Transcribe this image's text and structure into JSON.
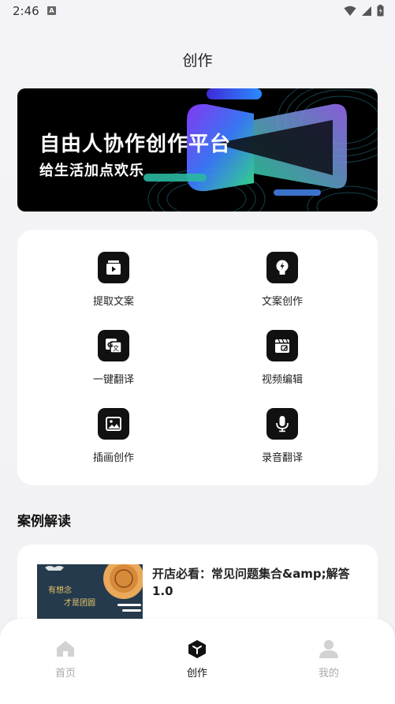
{
  "status": {
    "time": "2:46",
    "indicator": "A"
  },
  "page": {
    "title": "创作"
  },
  "banner": {
    "title": "自由人协作创作平台",
    "subtitle": "给生活加点欢乐"
  },
  "tools": [
    {
      "label": "提取文案",
      "icon": "video-extract-icon"
    },
    {
      "label": "文案创作",
      "icon": "lightbulb-icon"
    },
    {
      "label": "一键翻译",
      "icon": "translate-icon"
    },
    {
      "label": "视频编辑",
      "icon": "clapperboard-icon"
    },
    {
      "label": "插画创作",
      "icon": "image-icon"
    },
    {
      "label": "录音翻译",
      "icon": "microphone-icon"
    }
  ],
  "cases": {
    "heading": "案例解读",
    "items": [
      {
        "title": "开店必看：常见问题集合&amp;解答1.0",
        "thumb_text_1": "有想念",
        "thumb_text_2": "才是团圆"
      }
    ]
  },
  "nav": [
    {
      "label": "首页",
      "icon": "home-icon"
    },
    {
      "label": "创作",
      "icon": "cube-icon",
      "active": true
    },
    {
      "label": "我的",
      "icon": "user-icon"
    }
  ],
  "colors": {
    "accent": "#111111",
    "inactive": "#aaaaaa",
    "banner_gradient_start": "#3b7bff",
    "banner_gradient_end": "#35e08a"
  }
}
